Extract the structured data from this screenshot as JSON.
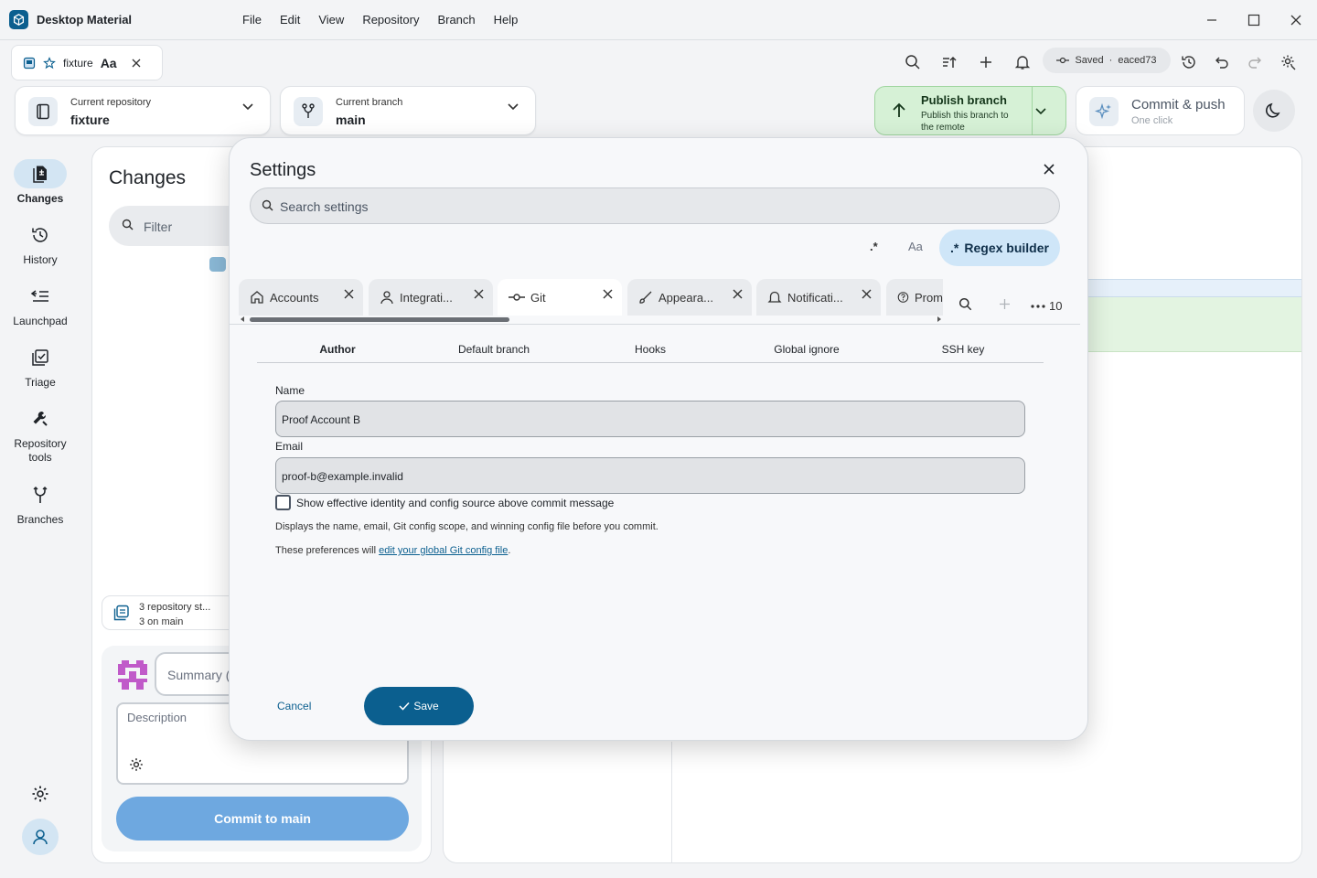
{
  "app": {
    "title": "Desktop Material"
  },
  "menu": [
    "File",
    "Edit",
    "View",
    "Repository",
    "Branch",
    "Help"
  ],
  "doc_tab": {
    "name": "fixture",
    "font_toggle": "Aa"
  },
  "status": {
    "saved_label": "Saved",
    "separator": "·",
    "commit": "eaced73"
  },
  "repo_selector": {
    "label": "Current repository",
    "value": "fixture"
  },
  "branch_selector": {
    "label": "Current branch",
    "value": "main"
  },
  "publish": {
    "title": "Publish branch",
    "subtitle": "Publish this branch to the remote"
  },
  "commit_push": {
    "title": "Commit & push",
    "subtitle": "One click"
  },
  "nav": [
    {
      "label": "Changes",
      "icon": "changes-icon",
      "active": true
    },
    {
      "label": "History",
      "icon": "history-icon"
    },
    {
      "label": "Launchpad",
      "icon": "launchpad-icon"
    },
    {
      "label": "Triage",
      "icon": "triage-icon"
    },
    {
      "label": "Repository tools",
      "icon": "wrench-icon"
    },
    {
      "label": "Branches",
      "icon": "branches-icon"
    }
  ],
  "changes": {
    "title": "Changes",
    "filter_placeholder": "Filter",
    "repo_status_line1": "3 repository st...",
    "repo_status_line2": "3 on main",
    "summary_placeholder": "Summary (",
    "description_placeholder": "Description",
    "commit_button": "Commit to main"
  },
  "settings": {
    "title": "Settings",
    "search_placeholder": "Search settings",
    "regex_toggle": ".*",
    "case_toggle": "Aa",
    "regex_builder": "Regex builder",
    "regex_builder_prefix": ".*",
    "tabs": [
      {
        "label": "Accounts",
        "icon": "home-icon"
      },
      {
        "label": "Integrati...",
        "icon": "person-icon"
      },
      {
        "label": "Git",
        "icon": "commit-icon",
        "active": true
      },
      {
        "label": "Appeara...",
        "icon": "brush-icon"
      },
      {
        "label": "Notificati...",
        "icon": "bell-icon"
      },
      {
        "label": "Prom",
        "icon": "help-icon"
      }
    ],
    "more_count": "10",
    "sub_tabs": [
      "Author",
      "Default branch",
      "Hooks",
      "Global ignore",
      "SSH key"
    ],
    "name_label": "Name",
    "name_value": "Proof Account B",
    "email_label": "Email",
    "email_value": "proof-b@example.invalid",
    "checkbox_label": "Show effective identity and config source above commit message",
    "hint1": "Displays the name, email, Git config scope, and winning config file before you commit.",
    "hint2_prefix": "These preferences will ",
    "hint2_link": "edit your global Git config file",
    "hint2_suffix": ".",
    "cancel": "Cancel",
    "save": "Save"
  },
  "colors": {
    "accent": "#0b5f8f",
    "publish_bg": "#d6f1d6",
    "commit_button": "#6ea8e0"
  }
}
